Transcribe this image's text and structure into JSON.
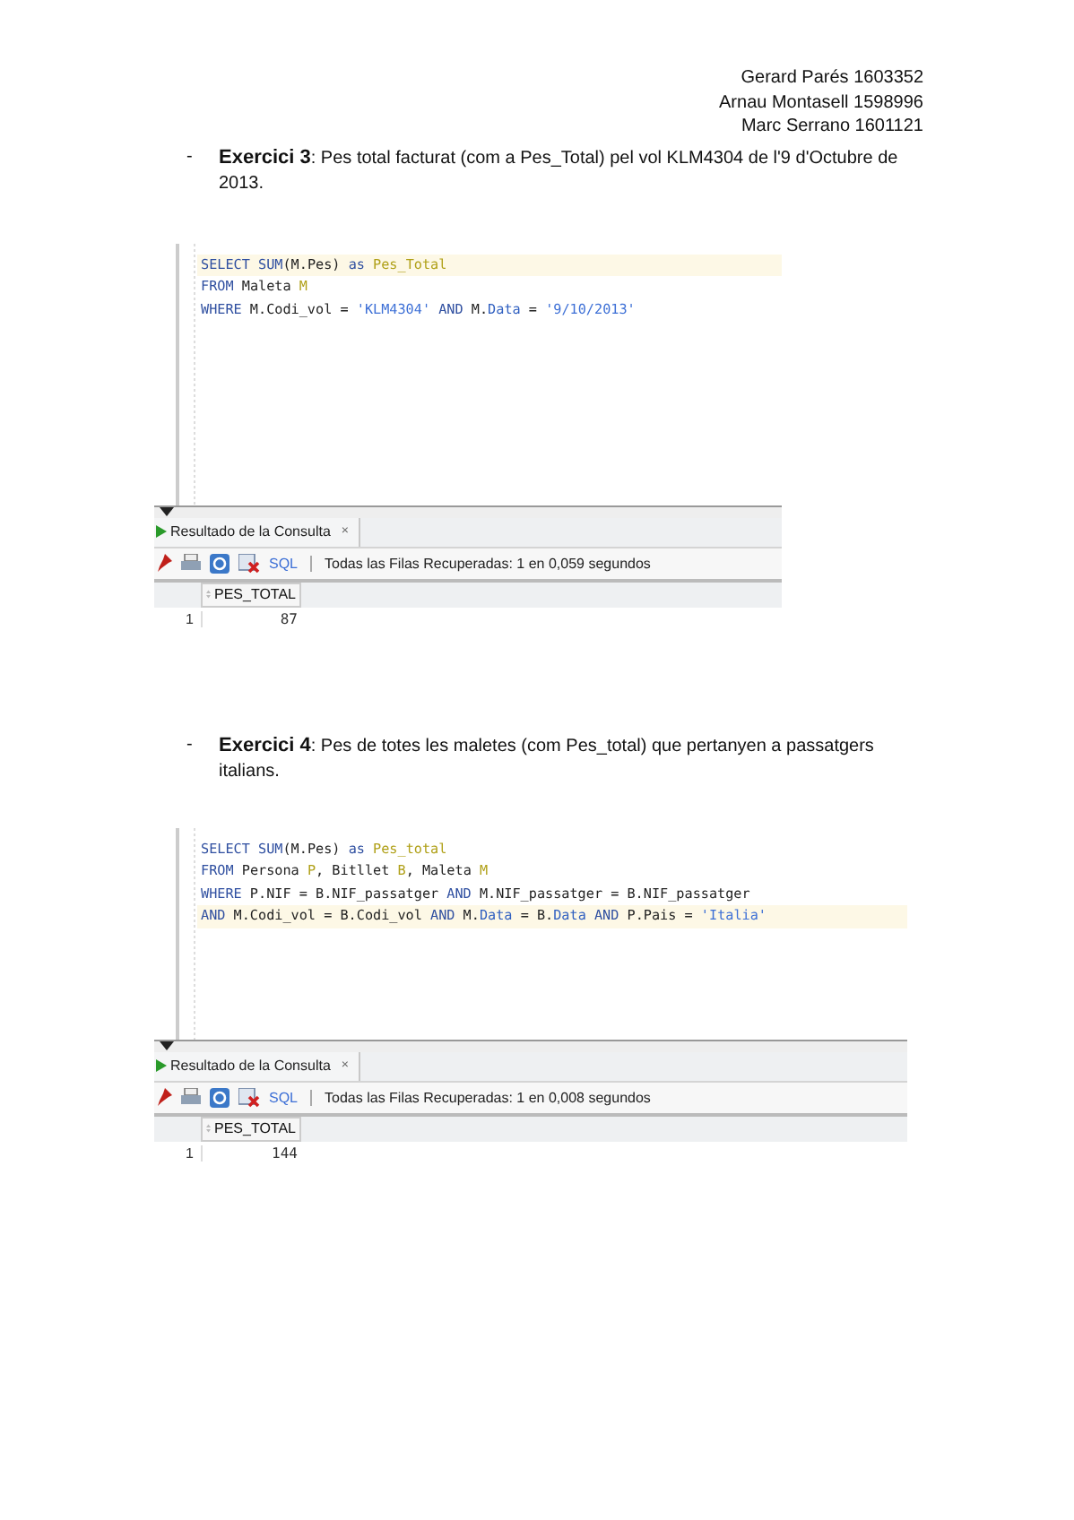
{
  "header": {
    "authors": [
      "Gerard Parés  1603352",
      "Arnau Montasell 1598996",
      "Marc Serrano 1601121"
    ]
  },
  "exercises": [
    {
      "bullet": "-",
      "title": "**Exercici 3**: Pes total facturat (com a Pes_Total) pel vol KLM4304 de l'9 d'Octubre de 2013.",
      "screenshot": {
        "code": [
          {
            "current": true,
            "tokens": [
              {
                "kind": "kw",
                "text": "SELECT"
              },
              {
                "kind": "kw",
                "text": " SUM"
              },
              {
                "kind": "plain",
                "text": "(M.Pes) "
              },
              {
                "kind": "kw",
                "text": "as"
              },
              {
                "kind": "alias",
                "text": " Pes_Total"
              }
            ]
          },
          {
            "current": false,
            "tokens": [
              {
                "kind": "kw",
                "text": "FROM"
              },
              {
                "kind": "plain",
                "text": " Maleta "
              },
              {
                "kind": "alias",
                "text": "M"
              }
            ]
          },
          {
            "current": false,
            "tokens": [
              {
                "kind": "kw",
                "text": "WHERE"
              },
              {
                "kind": "plain",
                "text": " M.Codi_vol = "
              },
              {
                "kind": "str",
                "text": "'KLM4304'"
              },
              {
                "kind": "kw",
                "text": " AND"
              },
              {
                "kind": "plain",
                "text": " M."
              },
              {
                "kind": "field",
                "text": "Data"
              },
              {
                "kind": "plain",
                "text": " = "
              },
              {
                "kind": "str",
                "text": "'9/10/2013'"
              }
            ]
          }
        ],
        "result_tab": {
          "label": "Resultado de la Consulta",
          "close": "×"
        },
        "sql_label": "SQL",
        "status": "Todas las Filas Recuperadas: 1 en 0,059 segundos",
        "columns": [
          "PES_TOTAL"
        ],
        "rows": [
          {
            "number": "1",
            "cells": [
              "87"
            ]
          }
        ]
      }
    },
    {
      "bullet": "-",
      "title": "**Exercici 4**: Pes de totes les maletes (com Pes_total) que pertanyen a passatgers italians.",
      "screenshot": {
        "code": [
          {
            "current": false,
            "tokens": [
              {
                "kind": "kw",
                "text": "SELECT"
              },
              {
                "kind": "kw",
                "text": " SUM"
              },
              {
                "kind": "plain",
                "text": "(M.Pes) "
              },
              {
                "kind": "kw",
                "text": "as"
              },
              {
                "kind": "alias",
                "text": " Pes_total"
              }
            ]
          },
          {
            "current": false,
            "tokens": [
              {
                "kind": "kw",
                "text": "FROM"
              },
              {
                "kind": "plain",
                "text": " Persona "
              },
              {
                "kind": "alias",
                "text": "P"
              },
              {
                "kind": "plain",
                "text": ", Bitllet "
              },
              {
                "kind": "alias",
                "text": "B"
              },
              {
                "kind": "plain",
                "text": ", Maleta "
              },
              {
                "kind": "alias",
                "text": "M"
              }
            ]
          },
          {
            "current": false,
            "tokens": [
              {
                "kind": "kw",
                "text": "WHERE"
              },
              {
                "kind": "plain",
                "text": " P.NIF = B.NIF_passatger "
              },
              {
                "kind": "kw",
                "text": "AND"
              },
              {
                "kind": "plain",
                "text": " M.NIF_passatger = B.NIF_passatger"
              }
            ]
          },
          {
            "current": true,
            "tokens": [
              {
                "kind": "kw",
                "text": "AND"
              },
              {
                "kind": "plain",
                "text": " M.Codi_vol = B.Codi_vol "
              },
              {
                "kind": "kw",
                "text": "AND"
              },
              {
                "kind": "plain",
                "text": " M."
              },
              {
                "kind": "field",
                "text": "Data"
              },
              {
                "kind": "plain",
                "text": " = B."
              },
              {
                "kind": "field",
                "text": "Data"
              },
              {
                "kind": "kw",
                "text": " AND"
              },
              {
                "kind": "plain",
                "text": " P.Pais = "
              },
              {
                "kind": "str",
                "text": "'Italia'"
              }
            ]
          }
        ],
        "result_tab": {
          "label": "Resultado de la Consulta",
          "close": "×"
        },
        "sql_label": "SQL",
        "status": "Todas las Filas Recuperadas: 1 en 0,008 segundos",
        "columns": [
          "PES_TOTAL"
        ],
        "rows": [
          {
            "number": "1",
            "cells": [
              "144"
            ]
          }
        ]
      }
    }
  ]
}
